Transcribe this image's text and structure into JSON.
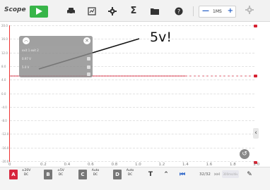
{
  "toolbar": {
    "app_title": "Scope",
    "timebase_value": "1MS",
    "timebase_minus": "—",
    "timebase_plus": "+"
  },
  "plot": {
    "y_ticks": [
      "20.0",
      "16.0",
      "12.0",
      "8.0",
      "4.0",
      "0.0",
      "-4.0",
      "-8.0",
      "-12.0",
      "-16.0",
      "-20.0"
    ],
    "x_ticks": [
      "0.2",
      "0.4",
      "0.6",
      "0.8",
      "1.0",
      "1.2",
      "1.4",
      "1.6",
      "1.8",
      "2.0"
    ],
    "x_origin": "0"
  },
  "panel": {
    "rows": [
      "exit 1    exit 2",
      "0.97 V",
      "5.0 V"
    ]
  },
  "annotation": "5v!",
  "bottombar": {
    "channels": [
      {
        "letter": "A",
        "line1": "±20V",
        "line2": "DC",
        "color": "#d7263d"
      },
      {
        "letter": "B",
        "line1": "±5V",
        "line2": "DC",
        "color": "#777777"
      },
      {
        "letter": "C",
        "line1": "Auto",
        "line2": "DC",
        "color": "#777777"
      },
      {
        "letter": "D",
        "line1": "Auto",
        "line2": "DC",
        "color": "#777777"
      }
    ],
    "page_indicator": "32/32",
    "disabled_label": "300ms/div"
  }
}
